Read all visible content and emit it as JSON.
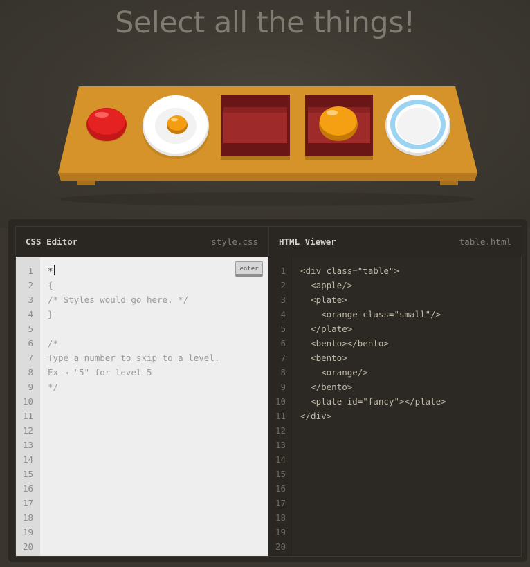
{
  "title": "Select all the things!",
  "table": {
    "items": [
      "apple",
      "plate-with-small-orange",
      "bento",
      "bento-with-orange",
      "fancy-plate"
    ]
  },
  "css_editor": {
    "title": "CSS Editor",
    "filename": "style.css",
    "enter_label": "enter",
    "lines": [
      "*",
      "{",
      "/* Styles would go here. */",
      "}",
      "",
      "/*",
      "Type a number to skip to a level.",
      "Ex → \"5\" for level 5",
      "*/"
    ],
    "line_numbers": [
      "1",
      "2",
      "3",
      "4",
      "5",
      "6",
      "7",
      "8",
      "9",
      "10",
      "11",
      "12",
      "13",
      "14",
      "15",
      "16",
      "17",
      "18",
      "19",
      "20"
    ]
  },
  "html_viewer": {
    "title": "HTML Viewer",
    "filename": "table.html",
    "lines": [
      "<div class=\"table\">",
      "  <apple/>",
      "  <plate>",
      "    <orange class=\"small\"/>",
      "  </plate>",
      "  <bento></bento>",
      "  <bento>",
      "    <orange/>",
      "  </bento>",
      "  <plate id=\"fancy\"></plate>",
      "</div>"
    ],
    "line_numbers": [
      "1",
      "2",
      "3",
      "4",
      "5",
      "6",
      "7",
      "8",
      "9",
      "10",
      "11",
      "12",
      "13",
      "14",
      "15",
      "16",
      "17",
      "18",
      "19",
      "20"
    ]
  },
  "colors": {
    "table_top": "#d9972c",
    "apple": "#e01e1e",
    "orange": "#f59d10",
    "bento": "#8e1e1e",
    "plate_rim": "#9bd3f0"
  }
}
